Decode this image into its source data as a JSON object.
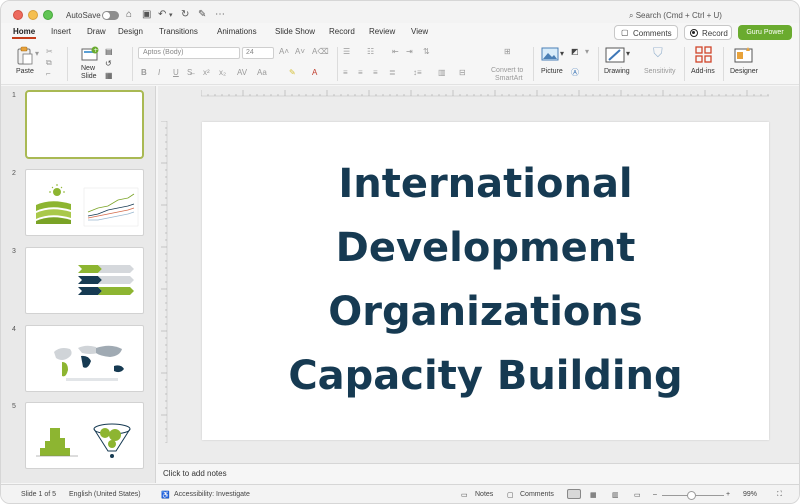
{
  "titlebar": {
    "autosave_label": "AutoSave",
    "search_placeholder": "Search (Cmd + Ctrl + U)"
  },
  "ribbon_tabs": [
    "Home",
    "Insert",
    "Draw",
    "Design",
    "Transitions",
    "Animations",
    "Slide Show",
    "Record",
    "Review",
    "View"
  ],
  "ribbon_actions": {
    "comments": "Comments",
    "record": "Record",
    "guru": "Guru Power"
  },
  "ribbon": {
    "paste": "Paste",
    "new_slide_line1": "New",
    "new_slide_line2": "Slide",
    "font_name": "Aptos (Body)",
    "font_size": "24",
    "convert_line1": "Convert to",
    "convert_line2": "SmartArt",
    "picture": "Picture",
    "drawing": "Drawing",
    "sensitivity": "Sensitivity",
    "addins": "Add-ins",
    "designer": "Designer"
  },
  "slides": [
    {
      "number": "1"
    },
    {
      "number": "2"
    },
    {
      "number": "3"
    },
    {
      "number": "4"
    },
    {
      "number": "5"
    }
  ],
  "main_slide": {
    "title_lines": [
      "International",
      "Development",
      "Organizations",
      "Capacity Building"
    ]
  },
  "notes_placeholder": "Click to add notes",
  "statusbar": {
    "slide_info": "Slide 1 of 5",
    "language": "English (United States)",
    "accessibility": "Accessibility: Investigate",
    "notes": "Notes",
    "comments": "Comments",
    "zoom": "99%"
  },
  "colors": {
    "accent_red": "#c43e1c",
    "brand_green": "#6aab2f",
    "title_navy": "#163a52",
    "thumb_select": "#a9b953"
  }
}
